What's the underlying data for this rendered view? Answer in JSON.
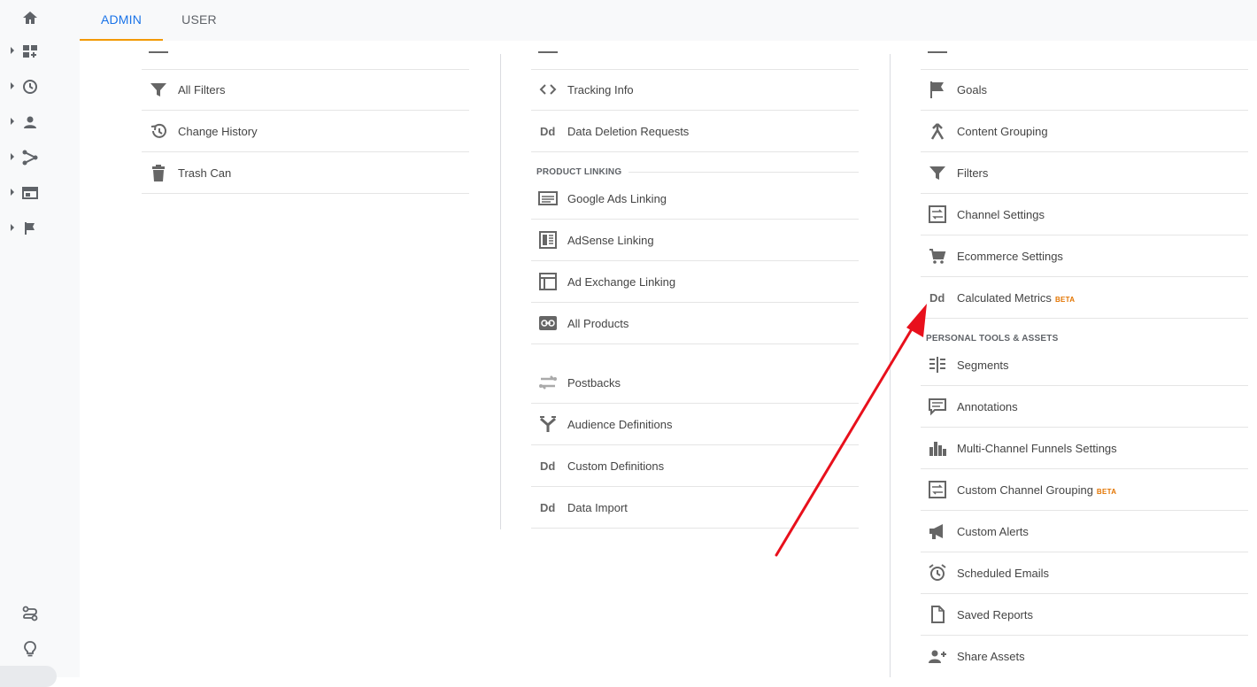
{
  "tabs": [
    {
      "label": "ADMIN",
      "active": true
    },
    {
      "label": "USER",
      "active": false
    }
  ],
  "left_nav": {
    "icons": [
      "home-icon",
      "customization-icon",
      "realtime-icon",
      "audience-icon",
      "acquisition-icon",
      "behavior-icon",
      "conversions-icon"
    ],
    "bottom_icons": [
      "attribution-icon",
      "discover-icon"
    ]
  },
  "account_column": {
    "items": [
      {
        "label": "All Filters",
        "icon": "filter-icon"
      },
      {
        "label": "Change History",
        "icon": "history-icon"
      },
      {
        "label": "Trash Can",
        "icon": "trash-icon"
      }
    ]
  },
  "property_column": {
    "items_top": [
      {
        "label": "Tracking Info",
        "icon": "code-icon"
      },
      {
        "label": "Data Deletion Requests",
        "icon": "dd-icon"
      }
    ],
    "product_linking_header": "PRODUCT LINKING",
    "product_linking": [
      {
        "label": "Google Ads Linking",
        "icon": "google-ads-icon"
      },
      {
        "label": "AdSense Linking",
        "icon": "adsense-icon"
      },
      {
        "label": "Ad Exchange Linking",
        "icon": "ad-exchange-icon"
      },
      {
        "label": "All Products",
        "icon": "link-icon"
      }
    ],
    "items_bottom": [
      {
        "label": "Postbacks",
        "icon": "postbacks-icon"
      },
      {
        "label": "Audience Definitions",
        "icon": "audience-definitions-icon"
      },
      {
        "label": "Custom Definitions",
        "icon": "dd-icon"
      },
      {
        "label": "Data Import",
        "icon": "dd-icon"
      }
    ]
  },
  "view_column": {
    "items": [
      {
        "label": "Goals",
        "icon": "flag-icon"
      },
      {
        "label": "Content Grouping",
        "icon": "content-grouping-icon"
      },
      {
        "label": "Filters",
        "icon": "filter-icon"
      },
      {
        "label": "Channel Settings",
        "icon": "channel-settings-icon"
      },
      {
        "label": "Ecommerce Settings",
        "icon": "cart-icon"
      },
      {
        "label": "Calculated Metrics",
        "icon": "dd-icon",
        "badge": "BETA"
      }
    ],
    "personal_header": "PERSONAL TOOLS & ASSETS",
    "personal_items": [
      {
        "label": "Segments",
        "icon": "segments-icon"
      },
      {
        "label": "Annotations",
        "icon": "annotations-icon"
      },
      {
        "label": "Multi-Channel Funnels Settings",
        "icon": "bar-chart-icon"
      },
      {
        "label": "Custom Channel Grouping",
        "icon": "channel-settings-icon",
        "badge": "BETA"
      },
      {
        "label": "Custom Alerts",
        "icon": "megaphone-icon"
      },
      {
        "label": "Scheduled Emails",
        "icon": "alarm-icon"
      },
      {
        "label": "Saved Reports",
        "icon": "document-icon"
      },
      {
        "label": "Share Assets",
        "icon": "add-person-icon"
      }
    ]
  },
  "colors": {
    "accent": "#1a73e8",
    "tab_underline": "#f29900",
    "beta": "#e37400",
    "annotation_arrow": "#e8101c"
  }
}
